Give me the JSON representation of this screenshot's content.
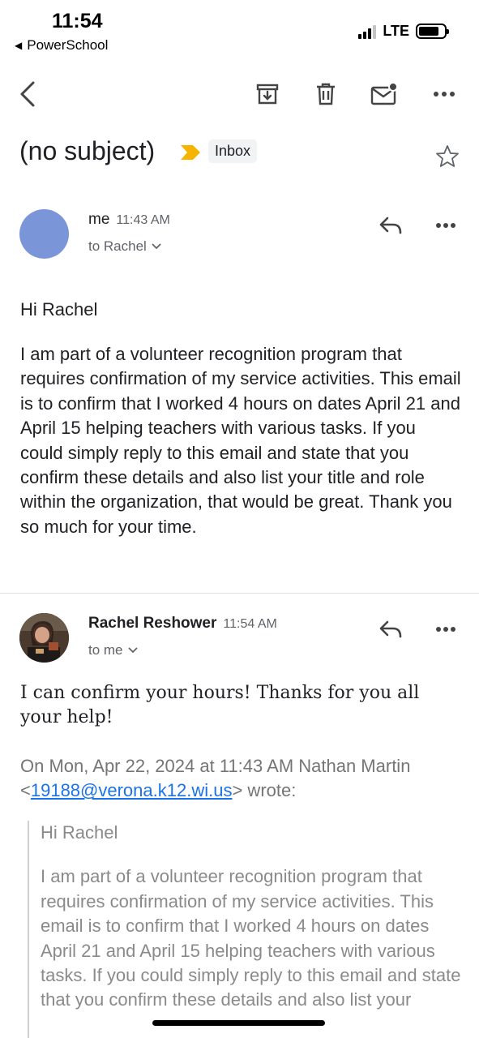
{
  "status_bar": {
    "time": "11:54",
    "back_app": "PowerSchool",
    "network": "LTE"
  },
  "toolbar": {
    "icons": [
      "back-icon",
      "archive-icon",
      "delete-icon",
      "mark-unread-icon",
      "more-icon"
    ]
  },
  "email": {
    "subject": "(no subject)",
    "label": "Inbox",
    "importance_color": "#f4b400"
  },
  "messages": [
    {
      "sender": "me",
      "time": "11:43 AM",
      "recipient": "to Rachel",
      "avatar_color": "#7b96d8",
      "greeting": "Hi Rachel",
      "body": "I am part of a volunteer recognition program that requires confirmation of my service activities. This email is to confirm that I worked 4 hours on dates April 21 and April 15 helping teachers with various tasks. If you could simply reply to this email and state that you confirm these details and also list your title and role within the organization, that would be great. Thank you so much for your time."
    },
    {
      "sender": "Rachel Reshower",
      "time": "11:54 AM",
      "recipient": "to me",
      "body": "I can confirm your hours! Thanks for you all your help!",
      "quote_header_before": "On Mon, Apr 22, 2024 at 11:43 AM Nathan Martin <",
      "quote_email": "19188@verona.k12.wi.us",
      "quote_header_after": "> wrote:",
      "quoted_greeting": "Hi Rachel",
      "quoted_body": "I am part of a volunteer recognition program that requires confirmation of my service activities. This email is to confirm that I worked 4 hours on dates April 21 and April 15 helping teachers with various tasks. If you could simply reply to this email and state that you confirm these details and also list your"
    }
  ]
}
